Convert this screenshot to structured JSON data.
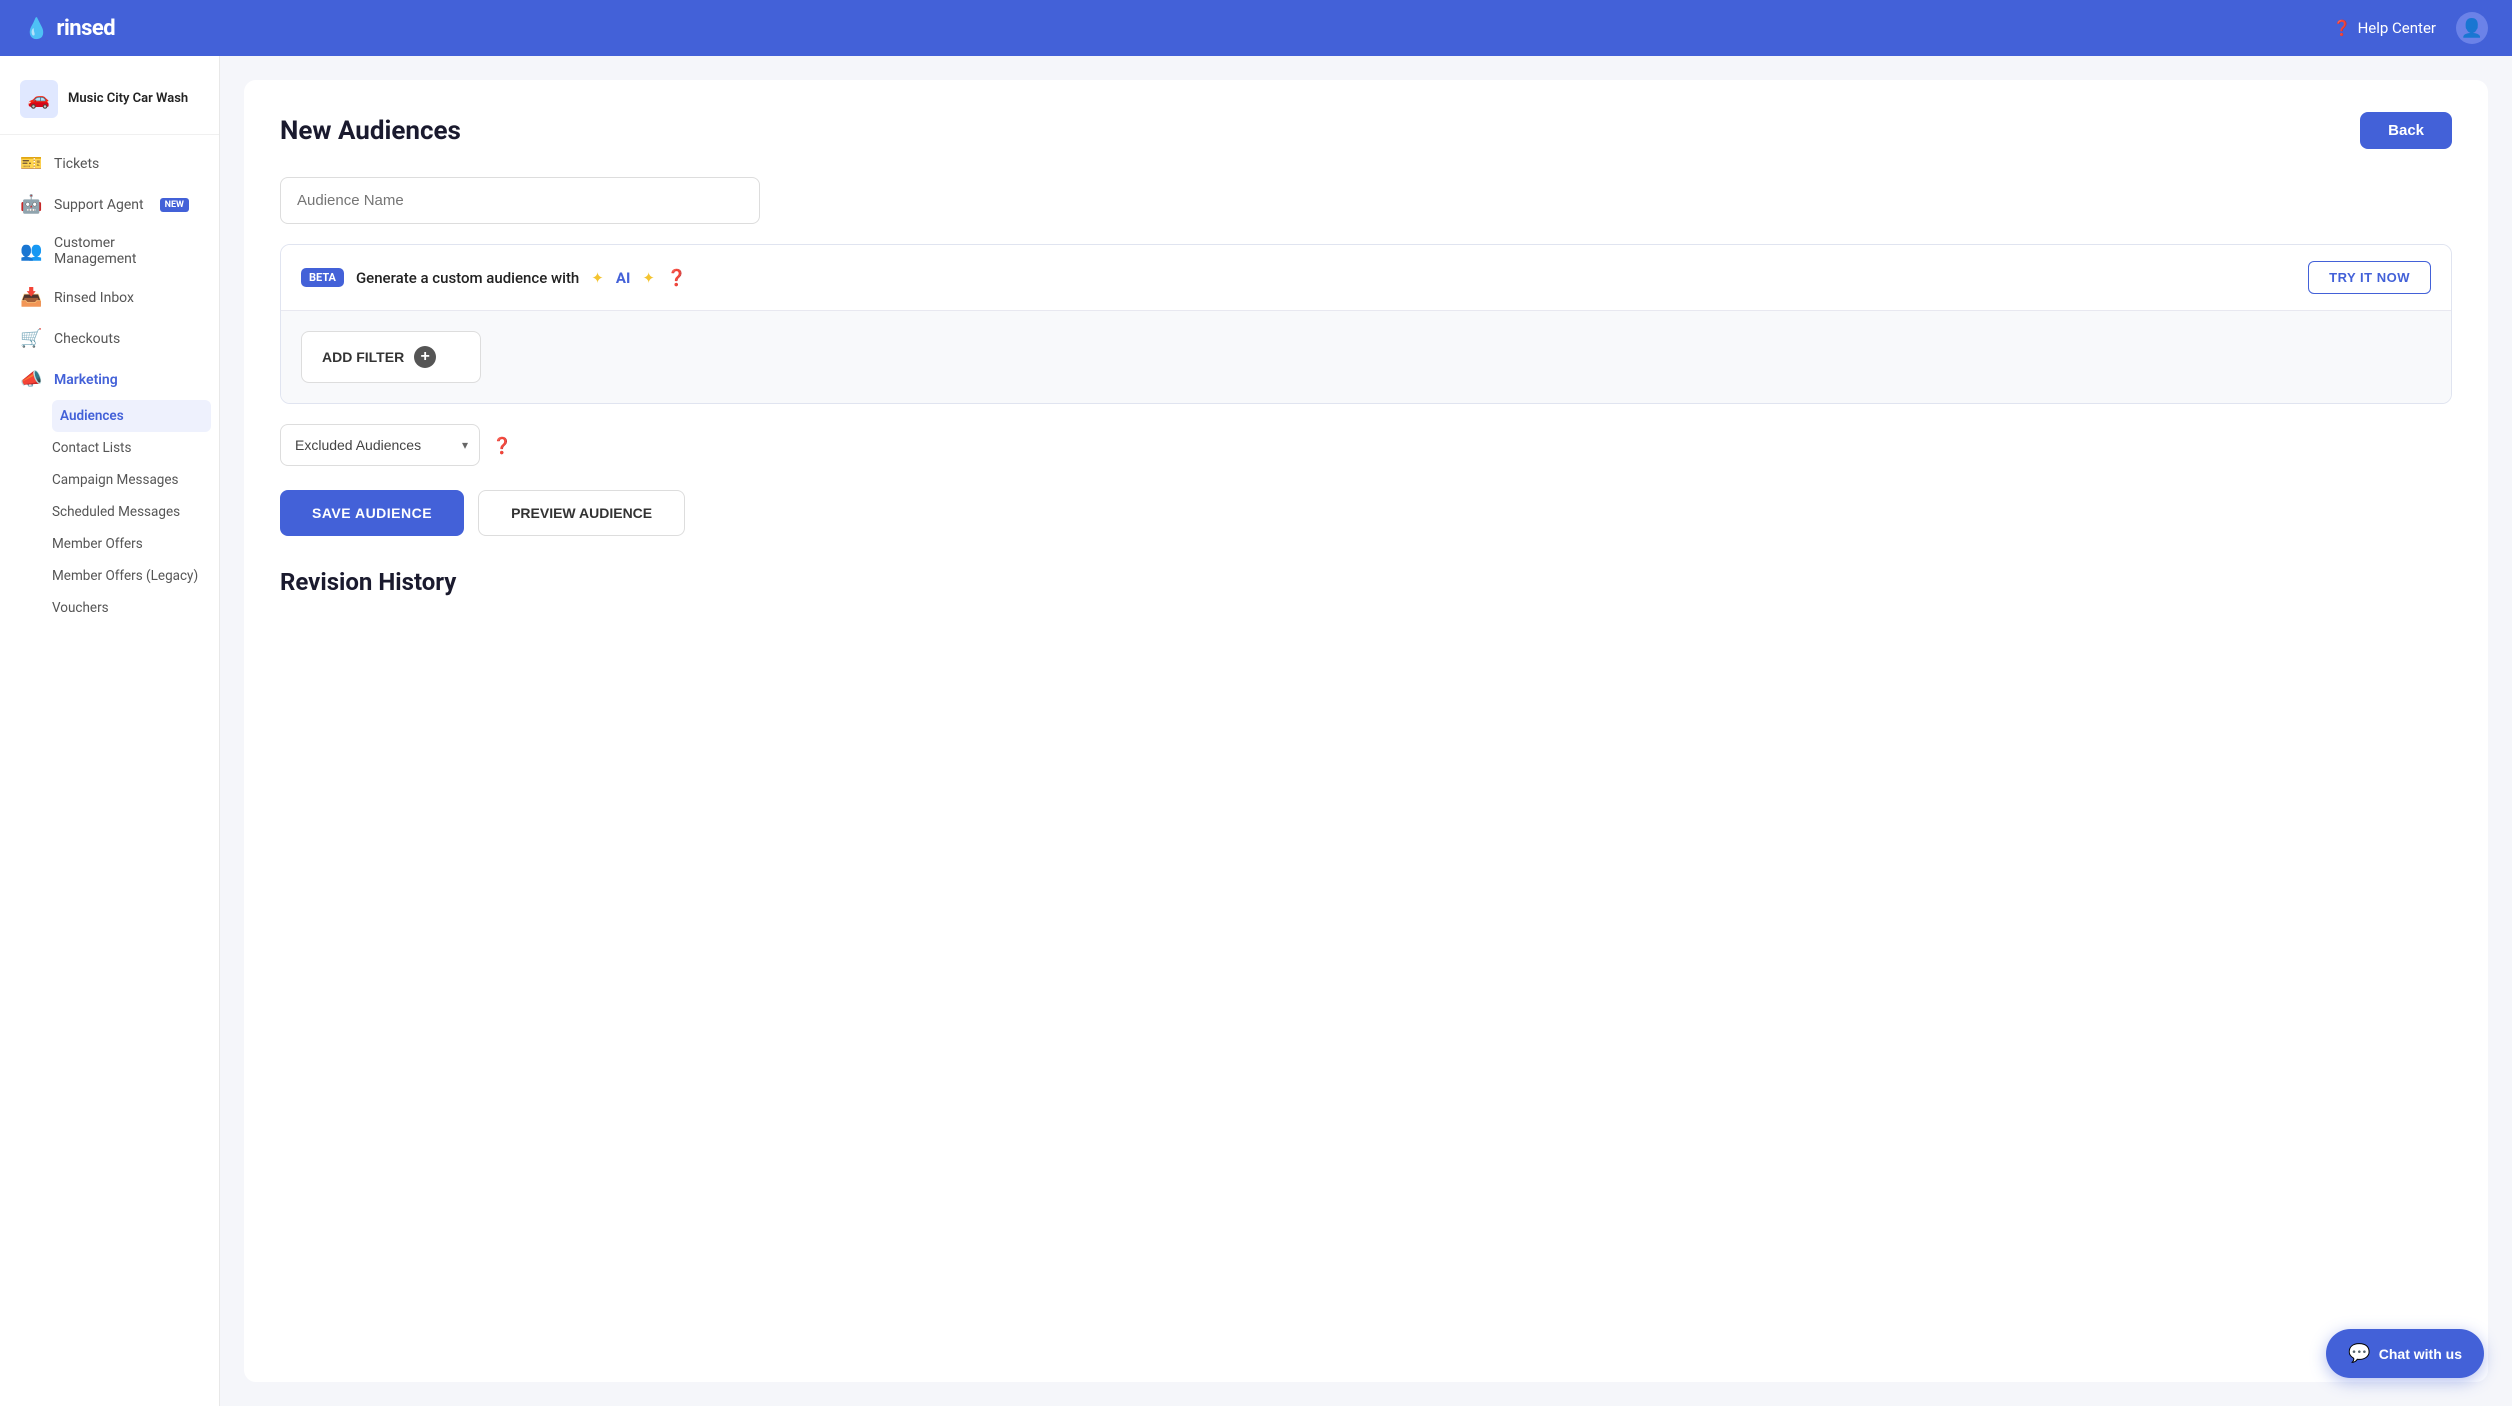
{
  "topnav": {
    "logo_text": "rinsed",
    "help_center_label": "Help Center",
    "drop_symbol": "💧"
  },
  "sidebar": {
    "brand_name": "Music City Car Wash",
    "items": [
      {
        "id": "tickets",
        "label": "Tickets",
        "icon": "🎫"
      },
      {
        "id": "support-agent",
        "label": "Support Agent",
        "icon": "🤖",
        "badge": "NEW"
      },
      {
        "id": "customer-management",
        "label": "Customer Management",
        "icon": "👥"
      },
      {
        "id": "rinsed-inbox",
        "label": "Rinsed Inbox",
        "icon": "📥"
      },
      {
        "id": "checkouts",
        "label": "Checkouts",
        "icon": "🛒"
      },
      {
        "id": "marketing",
        "label": "Marketing",
        "icon": "📣",
        "active": true
      }
    ],
    "marketing_sub": [
      {
        "id": "audiences",
        "label": "Audiences",
        "active": true
      },
      {
        "id": "contact-lists",
        "label": "Contact Lists"
      },
      {
        "id": "campaign-messages",
        "label": "Campaign Messages"
      },
      {
        "id": "scheduled-messages",
        "label": "Scheduled Messages"
      },
      {
        "id": "member-offers",
        "label": "Member Offers"
      },
      {
        "id": "member-offers-legacy",
        "label": "Member Offers (Legacy)"
      },
      {
        "id": "vouchers",
        "label": "Vouchers"
      }
    ]
  },
  "page": {
    "title": "New Audiences",
    "back_label": "Back",
    "audience_name_placeholder": "Audience Name",
    "ai_badge": "BETA",
    "ai_text_before": "Generate a custom audience with",
    "ai_text_highlight": "AI",
    "try_now_label": "TRY IT NOW",
    "add_filter_label": "ADD FILTER",
    "excluded_audiences_label": "Excluded Audiences",
    "save_audience_label": "SAVE AUDIENCE",
    "preview_audience_label": "PREVIEW AUDIENCE",
    "revision_history_title": "Revision History"
  },
  "chat": {
    "label": "Chat with us",
    "icon": "💬"
  }
}
